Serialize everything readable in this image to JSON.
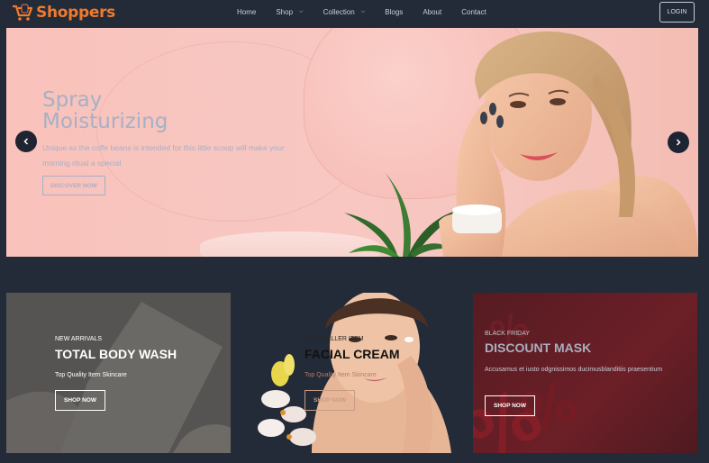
{
  "brand": {
    "name": "Shoppers",
    "accent": "#f07a2e"
  },
  "nav": {
    "items": [
      {
        "label": "Home",
        "caret": false
      },
      {
        "label": "Shop",
        "caret": true
      },
      {
        "label": "Collection",
        "caret": true
      },
      {
        "label": "Blogs",
        "caret": false
      },
      {
        "label": "About",
        "caret": false
      },
      {
        "label": "Contact",
        "caret": false
      }
    ],
    "login_label": "LOGIN"
  },
  "hero": {
    "title_line1": "Spray",
    "title_line2": "Moisturizing",
    "subtitle": "Unique as the coffe beans is intended for this little scoop will make your morning ritual a special",
    "cta_label": "DISCOVER NOW",
    "prev_icon": "chevron-left-icon",
    "next_icon": "chevron-right-icon"
  },
  "promos": [
    {
      "tag": "NEW ARRIVALS",
      "title": "TOTAL BODY WASH",
      "subtitle": "Top Quality Item Skincare",
      "button": "SHOP NOW"
    },
    {
      "tag": "BEST SELLER ITEM",
      "title": "FACIAL CREAM",
      "subtitle": "Top Quality Item Skincare",
      "button": "SHOP NOW"
    },
    {
      "tag": "BLACK FRIDAY",
      "title": "DISCOUNT MASK",
      "subtitle": "Accusamus et iusto odgnissimos ducimusblanditiis praesentium",
      "button": "SHOP NOW"
    }
  ]
}
